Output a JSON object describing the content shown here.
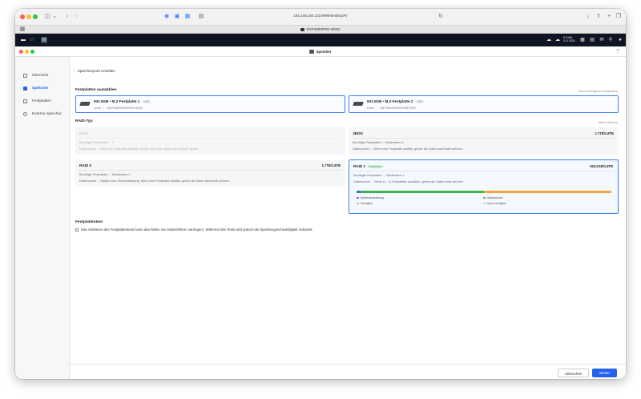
{
  "browser": {
    "url": "192.168.255.123:9999/desktop/#/",
    "tab_title": "DXP4800PRO-8DD2"
  },
  "taskbar": {
    "clock_line1": "8:3 Mitt.",
    "clock_line2": "4.11.2024"
  },
  "app": {
    "title": "Speicher"
  },
  "sidebar": {
    "items": [
      {
        "label": "Übersicht",
        "icon": "overview-icon"
      },
      {
        "label": "Speicher",
        "icon": "storage-icon"
      },
      {
        "label": "Festplatten",
        "icon": "disk-icon"
      },
      {
        "label": "Externe Speicher",
        "icon": "external-storage-icon"
      }
    ]
  },
  "main": {
    "breadcrumb": "Speicherpool erstellen",
    "disks_section": {
      "title": "Festplatten auswählen",
      "link": "Nicht verfügbare Festplatten",
      "disks": [
        {
          "name": "931.5GB • M.2-Festplatte 1",
          "type": "SSD",
          "status_label": "Leser",
          "serial": "SN:PMA39NR00130Y520C"
        },
        {
          "name": "931.5GB • M.2-Festplatte 2",
          "type": "SSD",
          "status_label": "Leser",
          "serial": "SN:PMA39NR00150FS20C"
        }
      ]
    },
    "raid_section": {
      "title": "RAID-Typ",
      "link": "Mehr erfahren",
      "cards": [
        {
          "name": "Basic",
          "capacity": "",
          "required_label": "Benötigte Festplatten",
          "required_value": "1",
          "protection_label": "Datenschutz",
          "protection_value": "Wenn die Festplatte ausfällt, werden die Daten dauerhaft verloren gehen."
        },
        {
          "name": "JBOD",
          "capacity": "1.7TB/1.8TB",
          "required_label": "Benötigte Festplatten",
          "required_value": "Mindestens 1",
          "protection_label": "Datenschutz",
          "protection_value": "Wenn eine Festplatte ausfällt, gehen die Daten dauerhaft verloren."
        },
        {
          "name": "RAID 0",
          "capacity": "1.7TB/1.8TB",
          "required_label": "Benötigte Festplatten",
          "required_value": "Mindestens 2",
          "protection_label": "Datenschutz",
          "protection_value": "Starke Lese-/Schreibleistung. Wenn eine Festplatte ausfällt, gehen die Daten dauerhaft verloren."
        },
        {
          "name": "RAID 1",
          "tag": "Empfohlen",
          "capacity": "916.2GB/1.8TB",
          "required_label": "Benötigte Festplatten",
          "required_value": "Mindestens 2",
          "protection_label": "Datenschutz",
          "protection_value": "Wenn (n - 1) Festplatten ausfallen, gehen die Daten nicht verloren."
        }
      ],
      "legend": [
        {
          "label": "Systemauslastung",
          "color": "#3b6fe0"
        },
        {
          "label": "Datenschutz",
          "color": "#3fb34f"
        },
        {
          "label": "Verfügbar",
          "color": "#f2a63b"
        },
        {
          "label": "Nicht verfügbar",
          "color": "#c9ccd2"
        }
      ],
      "usage_fraction": {
        "system": 0.015,
        "protection": 0.485,
        "available": 0.5,
        "unavailable": 0.0
      }
    },
    "disk_test": {
      "title": "Festplattentest",
      "checkbox_label": "Das Aktivieren des Festplattentests kann das Risiko von Datenfehlern verringern. Während des Tests wird jedoch die Speichergeschwindigkeit reduziert."
    },
    "footer": {
      "cancel": "Abbrechen",
      "next": "Weiter"
    }
  }
}
